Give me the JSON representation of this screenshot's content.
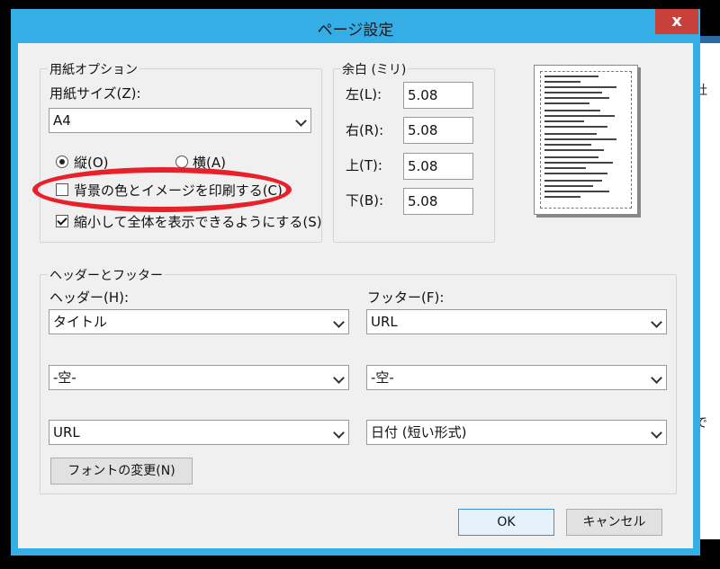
{
  "dialog": {
    "title": "ページ設定",
    "close_label": "x"
  },
  "paper": {
    "group_label": "用紙オプション",
    "size_label": "用紙サイズ(Z):",
    "size_value": "A4",
    "portrait_label": "縦(O)",
    "portrait_selected": true,
    "landscape_label": "横(A)",
    "landscape_selected": false,
    "print_bg_label": "背景の色とイメージを印刷する(C)",
    "print_bg_checked": false,
    "shrink_label": "縮小して全体を表示できるようにする(S)",
    "shrink_checked": true
  },
  "margins": {
    "group_label": "余白 (ミリ)",
    "left_label": "左(L):",
    "left_value": "5.08",
    "right_label": "右(R):",
    "right_value": "5.08",
    "top_label": "上(T):",
    "top_value": "5.08",
    "bottom_label": "下(B):",
    "bottom_value": "5.08"
  },
  "header_footer": {
    "group_label": "ヘッダーとフッター",
    "header_label": "ヘッダー(H):",
    "footer_label": "フッター(F):",
    "header_1": "タイトル",
    "header_2": "-空-",
    "header_3": "URL",
    "footer_1": "URL",
    "footer_2": "-空-",
    "footer_3": "日付 (短い形式)",
    "font_button": "フォントの変更(N)"
  },
  "buttons": {
    "ok": "OK",
    "cancel": "キャンセル"
  },
  "background_app": {
    "fragment_1": "社",
    "fragment_2": "で"
  },
  "colors": {
    "title_bar": "#35aee6",
    "close_button": "#c7403a",
    "highlight_ellipse": "#e8202a"
  }
}
